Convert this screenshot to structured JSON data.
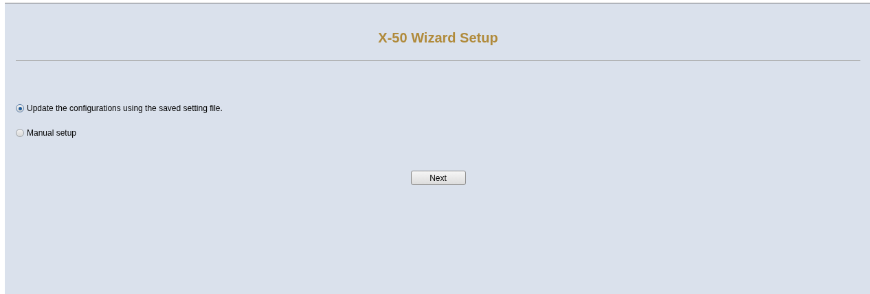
{
  "title": "X-50 Wizard Setup",
  "options": [
    {
      "label": "Update the configurations using the saved setting file.",
      "selected": true
    },
    {
      "label": "Manual setup",
      "selected": false
    }
  ],
  "buttons": [
    "Next"
  ]
}
